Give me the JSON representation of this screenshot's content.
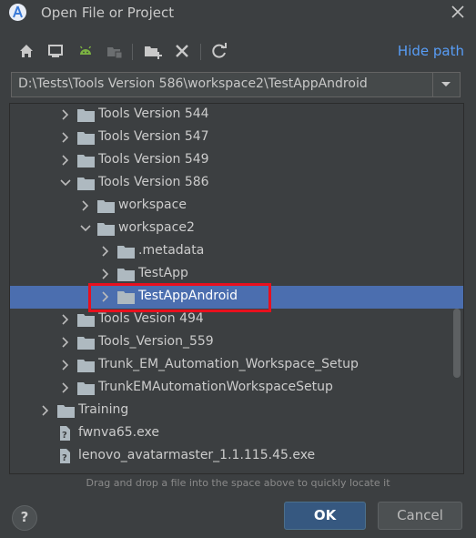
{
  "window": {
    "title": "Open File or Project"
  },
  "toolbar": {
    "icons": [
      "home-icon",
      "desktop-icon",
      "android-icon",
      "module-icon",
      "new-folder-icon",
      "delete-icon",
      "refresh-icon"
    ],
    "hide_path_label": "Hide path"
  },
  "path": {
    "value": "D:\\Tests\\Tools Version 586\\workspace2\\TestAppAndroid"
  },
  "tree": {
    "rows": [
      {
        "label": "Tools Version 544",
        "kind": "folder",
        "expanded": false
      },
      {
        "label": "Tools Version 547",
        "kind": "folder",
        "expanded": false
      },
      {
        "label": "Tools Version 549",
        "kind": "folder",
        "expanded": false
      },
      {
        "label": "Tools Version 586",
        "kind": "folder",
        "expanded": true
      },
      {
        "label": "workspace",
        "kind": "folder",
        "expanded": false
      },
      {
        "label": "workspace2",
        "kind": "folder",
        "expanded": true
      },
      {
        "label": ".metadata",
        "kind": "folder",
        "expanded": false
      },
      {
        "label": "TestApp",
        "kind": "folder",
        "expanded": false
      },
      {
        "label": "TestAppAndroid",
        "kind": "folder",
        "expanded": false,
        "selected": true
      },
      {
        "label": "Tools Vesion 494",
        "kind": "folder",
        "expanded": false
      },
      {
        "label": "Tools_Version_559",
        "kind": "folder",
        "expanded": false
      },
      {
        "label": "Trunk_EM_Automation_Workspace_Setup",
        "kind": "folder",
        "expanded": false
      },
      {
        "label": "TrunkEMAutomationWorkspaceSetup",
        "kind": "folder",
        "expanded": false
      },
      {
        "label": "Training",
        "kind": "folder",
        "expanded": false
      },
      {
        "label": "fwnva65.exe",
        "kind": "file"
      },
      {
        "label": "lenovo_avatarmaster_1.1.115.45.exe",
        "kind": "file"
      }
    ]
  },
  "hint": "Drag and drop a file into the space above to quickly locate it",
  "buttons": {
    "help": "?",
    "ok": "OK",
    "cancel": "Cancel"
  },
  "colors": {
    "background": "#3c3f41",
    "selection": "#4b6eaf",
    "link": "#589df6",
    "highlight_box": "#e8101e",
    "ok_button": "#365880"
  }
}
